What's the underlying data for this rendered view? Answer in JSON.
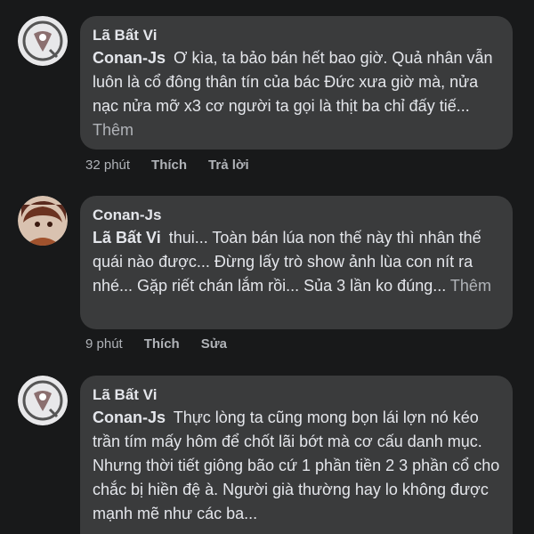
{
  "comments": [
    {
      "author": "Lã Bất Vi",
      "mention": "Conan-Js",
      "text": "Ơ kìa, ta bảo bán hết bao giờ. Quả nhân vẫn luôn là cổ đông thân tín của bác Đức xưa giờ mà, nửa nạc nửa mỡ x3 cơ người ta gọi là thịt ba chỉ đấy tiế...",
      "more": "Thêm",
      "time": "32 phút",
      "actions": [
        "Thích",
        "Trả lời"
      ],
      "avatar": "seal-logo-avatar"
    },
    {
      "author": "Conan-Js",
      "mention": "Lã Bất Vi",
      "text": "thui... Toàn bán lúa non thế này thì nhân thế quái nào được... Đừng lấy trò show ảnh lùa con nít ra nhé... Gặp riết chán lắm rồi... Sủa 3 lần ko đúng...",
      "more": "Thêm",
      "time": "9 phút",
      "actions": [
        "Thích",
        "Sửa"
      ],
      "avatar": "anime-character-avatar"
    },
    {
      "author": "Lã Bất Vi",
      "mention": "Conan-Js",
      "text": "Thực lòng ta cũng mong bọn lái lợn nó kéo trần tím mấy hôm để chốt lãi bớt mà cơ cấu danh mục. Nhưng thời tiết giông bão cứ 1 phần tiền 2 3 phần cổ cho chắc bị hiền đệ à. Người già thường hay lo không được mạnh mẽ như các ba...",
      "avatar": "seal-logo-avatar"
    }
  ],
  "colors": {
    "background": "#18191a",
    "bubble": "#3a3b3c",
    "text": "#e4e6eb",
    "secondary": "#b0b3b8"
  }
}
